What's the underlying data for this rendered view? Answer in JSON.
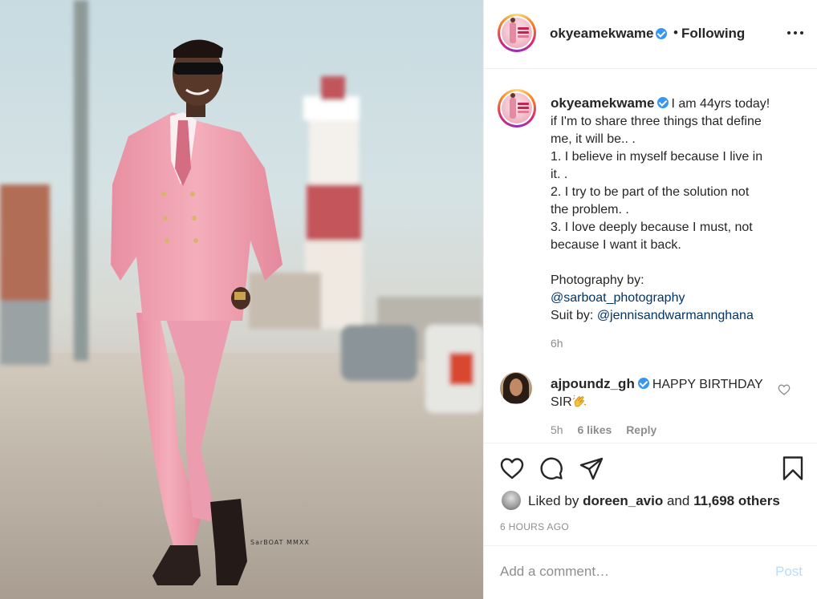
{
  "post": {
    "photo_watermark": "SarBOAT MMXX",
    "photo_alt": "Man in pink double-breasted suit standing on a street"
  },
  "header": {
    "username": "okyeamekwame",
    "separator": "•",
    "follow_status": "Following",
    "more_icon": "more-horizontal-icon"
  },
  "caption": {
    "username": "okyeamekwame",
    "lines": [
      "I am 44yrs today!",
      "if I'm to share three things that define",
      "me, it will be.. .",
      "1. I believe in myself because I live in",
      "it. .",
      "2. I try to be part of the solution not",
      "the problem. .",
      "3. I love deeply because I must, not",
      "because I want it back."
    ],
    "photography_label": "Photography by:",
    "photography_mention": "@sarboat_photography",
    "suit_label": "Suit by:",
    "suit_mention": "@jennisandwarmannghana",
    "time": "6h"
  },
  "comment": {
    "username": "ajpoundz_gh",
    "text_line1": "HAPPY BIRTHDAY",
    "text_line2": "SIR",
    "emoji_icon": "clapping-hands-icon",
    "time": "5h",
    "likes": "6 likes",
    "reply": "Reply"
  },
  "actions": {
    "like_icon": "heart-icon",
    "comment_icon": "comment-icon",
    "share_icon": "paper-plane-icon",
    "save_icon": "bookmark-icon"
  },
  "likes": {
    "prefix": "Liked by",
    "user": "doreen_avio",
    "joiner": "and",
    "others": "11,698 others"
  },
  "timestamp": "6 HOURS AGO",
  "add_comment": {
    "placeholder": "Add a comment…",
    "post_label": "Post"
  },
  "colors": {
    "verified_blue": "#3897f0",
    "mention_blue": "#003569",
    "post_button_disabled": "#b2dffc",
    "secondary_text": "#8e8e8e",
    "suit_pink": "#f0a1b0"
  }
}
